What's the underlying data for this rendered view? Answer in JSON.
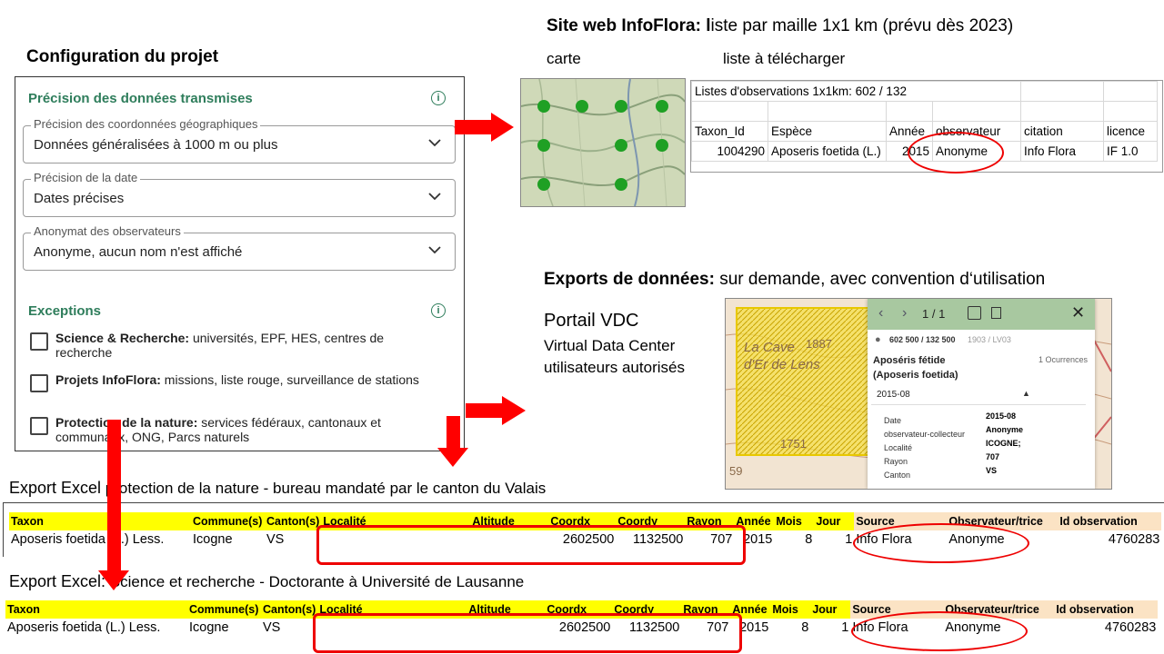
{
  "config": {
    "title": "Configuration du projet",
    "precision_title": "Précision des données transmises",
    "fields": [
      {
        "legend": "Précision des coordonnées géographiques",
        "value": "Données généralisées à 1000 m ou plus"
      },
      {
        "legend": "Précision de la date",
        "value": "Dates précises"
      },
      {
        "legend": "Anonymat des observateurs",
        "value": "Anonyme, aucun nom n'est affiché"
      }
    ],
    "exceptions_title": "Exceptions",
    "exceptions": [
      {
        "bold": "Science & Recherche:",
        "text": " universités, EPF, HES, centres de recherche"
      },
      {
        "bold": "Projets InfoFlora:",
        "text": " missions, liste rouge, surveillance de stations"
      },
      {
        "bold": "Protection de la nature:",
        "text": " services fédéraux, cantonaux et communaux, ONG, Parcs naturels"
      }
    ]
  },
  "site": {
    "title_bold": "Site web InfoFlora: l",
    "title_rest": "iste par maille 1x1 km (prévu dès 2023)",
    "carte": "carte",
    "liste": "liste à télécharger",
    "sheet_title": "Listes d'observations 1x1km:  602 / 132",
    "sheet_headers": [
      "Taxon_Id",
      "Espèce",
      "Année",
      "observateur",
      "citation",
      "licence"
    ],
    "sheet_row": [
      "1004290",
      "Aposeris foetida (L.)",
      "2015",
      "Anonyme",
      "Info Flora",
      "IF 1.0"
    ]
  },
  "exports": {
    "title_bold": "Exports de données:",
    "title_rest": " sur demande, avec convention d‘utilisation",
    "portal_line1": "Portail VDC",
    "portal_line2": "Virtual Data Center",
    "portal_line3": "utilisateurs autorisés"
  },
  "portal": {
    "pager": "1 / 1",
    "coords": "602 500 / 132 500",
    "coords_extra": "1903 / LV03",
    "species": "Aposéris fétide",
    "species_latin": "(Aposeris foetida)",
    "occurrences": "1 Ocurrences",
    "date_group": "2015-08",
    "details": [
      {
        "k": "Date",
        "v": "2015-08"
      },
      {
        "k": "observateur-collecteur",
        "v": "Anonyme"
      },
      {
        "k": "Localité",
        "v": "ICOGNE;"
      },
      {
        "k": "Rayon",
        "v": "707"
      },
      {
        "k": "Canton",
        "v": "VS"
      }
    ],
    "map_label1": "La Cave",
    "map_label2": "d'Er de Lens",
    "map_label3": "1887",
    "map_label4": "1751",
    "map_label5": "59"
  },
  "export1": {
    "caption_lead": "Export Excel",
    "caption_rest": " protection de la nature - bureau mandaté par le canton du Valais"
  },
  "export2": {
    "caption_lead": "Export Excel:",
    "caption_rest": " Science et recherche - Doctorante à Université de Lausanne"
  },
  "table": {
    "headers": [
      "Taxon",
      "Commune(s)",
      "Canton(s)",
      "Localité",
      "Altitude",
      "Coordx",
      "Coordy",
      "Rayon",
      "Année",
      "Mois",
      "Jour",
      "Source",
      "Observateur/trice",
      "Id observation"
    ],
    "row": [
      "Aposeris foetida (L.) Less.",
      "Icogne",
      "VS",
      "",
      "",
      "2602500",
      "1132500",
      "707",
      "2015",
      "8",
      "1",
      "Info Flora",
      "Anonyme",
      "4760283"
    ]
  },
  "colors": {
    "accent_green": "#2e7d5b",
    "highlight_red": "#e00000",
    "header_yellow": "#ffff00",
    "header_peach": "#fbe3c4",
    "dot_green": "#1fa024"
  }
}
